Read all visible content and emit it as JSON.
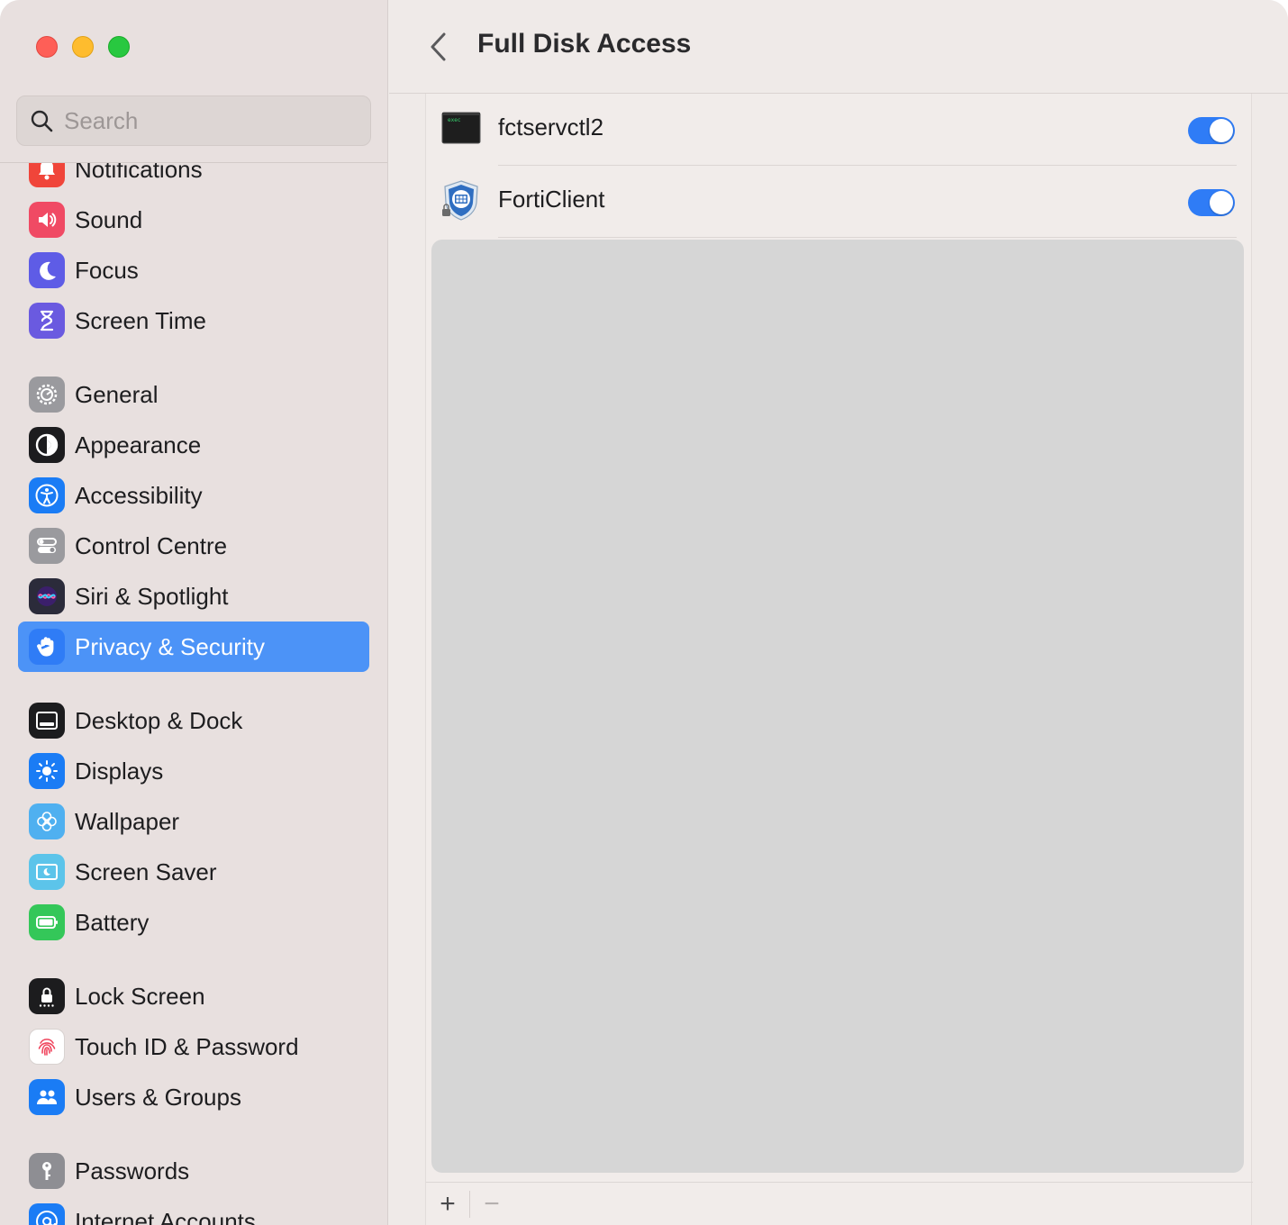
{
  "window": {
    "traffic_lights": [
      "close",
      "minimize",
      "maximize"
    ]
  },
  "search": {
    "placeholder": "Search",
    "value": ""
  },
  "sidebar": {
    "items": [
      {
        "label": "Notifications",
        "icon": "bell-icon",
        "color": "#f0453a"
      },
      {
        "label": "Sound",
        "icon": "speaker-icon",
        "color": "#f04a64"
      },
      {
        "label": "Focus",
        "icon": "moon-icon",
        "color": "#5e5ce6"
      },
      {
        "label": "Screen Time",
        "icon": "hourglass-icon",
        "color": "#6a5ae0"
      },
      {
        "label": "General",
        "icon": "gear-icon",
        "color": "#9a9a9e"
      },
      {
        "label": "Appearance",
        "icon": "appearance-icon",
        "color": "#1c1c1e"
      },
      {
        "label": "Accessibility",
        "icon": "accessibility-icon",
        "color": "#1a7cf5"
      },
      {
        "label": "Control Centre",
        "icon": "control-centre-icon",
        "color": "#9a9a9e"
      },
      {
        "label": "Siri & Spotlight",
        "icon": "siri-icon",
        "color": "#2b2b3a"
      },
      {
        "label": "Privacy & Security",
        "icon": "hand-icon",
        "color": "#2f7cf6",
        "selected": true
      },
      {
        "label": "Desktop & Dock",
        "icon": "dock-icon",
        "color": "#1c1c1e"
      },
      {
        "label": "Displays",
        "icon": "sun-icon",
        "color": "#1a7cf5"
      },
      {
        "label": "Wallpaper",
        "icon": "flower-icon",
        "color": "#4fb0f0"
      },
      {
        "label": "Screen Saver",
        "icon": "screensaver-icon",
        "color": "#5cc4ea"
      },
      {
        "label": "Battery",
        "icon": "battery-icon",
        "color": "#34c759"
      },
      {
        "label": "Lock Screen",
        "icon": "lock-icon",
        "color": "#1c1c1e"
      },
      {
        "label": "Touch ID & Password",
        "icon": "fingerprint-icon",
        "color": "#ffffff"
      },
      {
        "label": "Users & Groups",
        "icon": "users-icon",
        "color": "#1a7cf5"
      },
      {
        "label": "Passwords",
        "icon": "key-icon",
        "color": "#8e8e93"
      },
      {
        "label": "Internet Accounts",
        "icon": "at-icon",
        "color": "#1a7cf5"
      }
    ]
  },
  "header": {
    "title": "Full Disk Access",
    "back_icon": "chevron-left-icon"
  },
  "apps": [
    {
      "name": "fctservctl2",
      "icon": "exec-terminal-icon",
      "icon_text": "exec",
      "enabled": true
    },
    {
      "name": "FortiClient",
      "icon": "forticlient-shield-icon",
      "enabled": true
    }
  ],
  "footer": {
    "add": "+",
    "remove": "−"
  },
  "colors": {
    "accent": "#2f7cf6",
    "selection": "#4c93f7",
    "sidebar_bg": "#e8e0df",
    "main_bg": "#efeae8"
  }
}
